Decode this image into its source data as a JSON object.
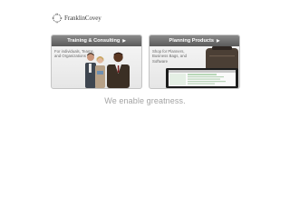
{
  "brand": {
    "name": "FranklinCovey"
  },
  "cards": [
    {
      "title": "Training & Consulting",
      "arrow": "▶",
      "description": "For individuals, Teams, and Organizations"
    },
    {
      "title": "Planning Products",
      "arrow": "▶",
      "description": "Shop for Planners, Business Bags, and Software"
    }
  ],
  "tagline": "We enable greatness.",
  "colors": {
    "header_dark": "#5a5a5a",
    "header_light": "#8a8a8a",
    "tagline": "#a3a3a3",
    "card_body": "#efefef"
  },
  "icons": [
    "franklincovey-logo-icon",
    "arrow-right-icon"
  ]
}
